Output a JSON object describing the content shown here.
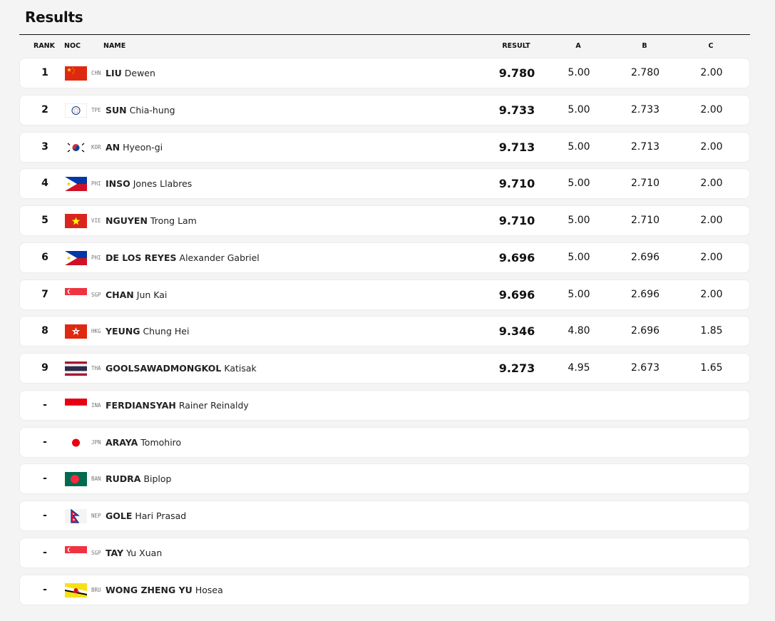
{
  "page": {
    "title": "Results"
  },
  "columns": {
    "rank": "RANK",
    "noc": "NOC",
    "name": "NAME",
    "result": "RESULT",
    "a": "A",
    "b": "B",
    "c": "C"
  },
  "rows": [
    {
      "rank": "1",
      "noc": "CHN",
      "surname": "LIU",
      "given": "Dewen",
      "result": "9.780",
      "a": "5.00",
      "b": "2.780",
      "c": "2.00"
    },
    {
      "rank": "2",
      "noc": "TPE",
      "surname": "SUN",
      "given": "Chia-hung",
      "result": "9.733",
      "a": "5.00",
      "b": "2.733",
      "c": "2.00"
    },
    {
      "rank": "3",
      "noc": "KOR",
      "surname": "AN",
      "given": "Hyeon-gi",
      "result": "9.713",
      "a": "5.00",
      "b": "2.713",
      "c": "2.00"
    },
    {
      "rank": "4",
      "noc": "PHI",
      "surname": "INSO",
      "given": "Jones Llabres",
      "result": "9.710",
      "a": "5.00",
      "b": "2.710",
      "c": "2.00"
    },
    {
      "rank": "5",
      "noc": "VIE",
      "surname": "NGUYEN",
      "given": "Trong Lam",
      "result": "9.710",
      "a": "5.00",
      "b": "2.710",
      "c": "2.00"
    },
    {
      "rank": "6",
      "noc": "PHI",
      "surname": "DE LOS REYES",
      "given": "Alexander Gabriel",
      "result": "9.696",
      "a": "5.00",
      "b": "2.696",
      "c": "2.00"
    },
    {
      "rank": "7",
      "noc": "SGP",
      "surname": "CHAN",
      "given": "Jun Kai",
      "result": "9.696",
      "a": "5.00",
      "b": "2.696",
      "c": "2.00"
    },
    {
      "rank": "8",
      "noc": "HKG",
      "surname": "YEUNG",
      "given": "Chung Hei",
      "result": "9.346",
      "a": "4.80",
      "b": "2.696",
      "c": "1.85"
    },
    {
      "rank": "9",
      "noc": "THA",
      "surname": "GOOLSAWADMONGKOL",
      "given": "Katisak",
      "result": "9.273",
      "a": "4.95",
      "b": "2.673",
      "c": "1.65"
    },
    {
      "rank": "-",
      "noc": "INA",
      "surname": "FERDIANSYAH",
      "given": "Rainer Reinaldy",
      "result": "",
      "a": "",
      "b": "",
      "c": ""
    },
    {
      "rank": "-",
      "noc": "JPN",
      "surname": "ARAYA",
      "given": "Tomohiro",
      "result": "",
      "a": "",
      "b": "",
      "c": ""
    },
    {
      "rank": "-",
      "noc": "BAN",
      "surname": "RUDRA",
      "given": "Biplop",
      "result": "",
      "a": "",
      "b": "",
      "c": ""
    },
    {
      "rank": "-",
      "noc": "NEP",
      "surname": "GOLE",
      "given": "Hari Prasad",
      "result": "",
      "a": "",
      "b": "",
      "c": ""
    },
    {
      "rank": "-",
      "noc": "SGP",
      "surname": "TAY",
      "given": "Yu Xuan",
      "result": "",
      "a": "",
      "b": "",
      "c": ""
    },
    {
      "rank": "-",
      "noc": "BRU",
      "surname": "WONG ZHENG YU",
      "given": "Hosea",
      "result": "",
      "a": "",
      "b": "",
      "c": ""
    }
  ]
}
